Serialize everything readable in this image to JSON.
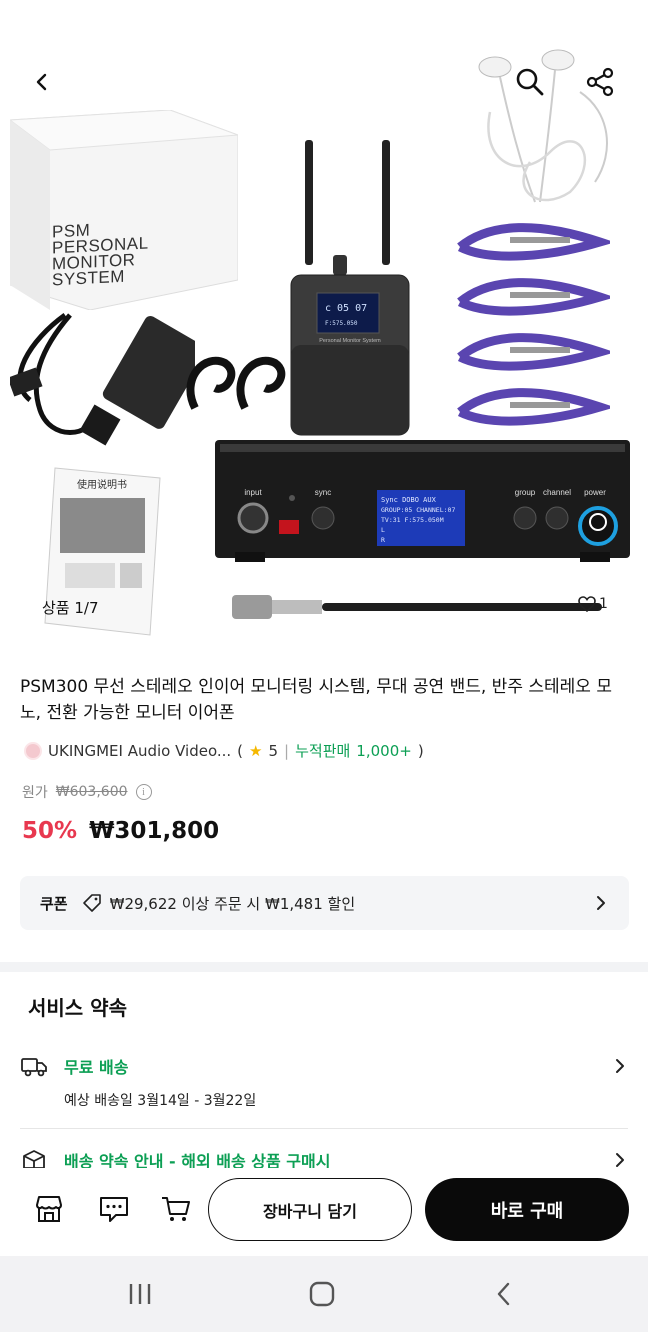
{
  "hero": {
    "box_text": [
      "PSM",
      "PERSONAL",
      "MONITOR",
      "SYSTEM"
    ],
    "counter": "상품 1/7",
    "likes": "1",
    "receiver_label": "Personal Monitor System",
    "manual_label": "使用说明书",
    "transmitter": {
      "input_label": "input",
      "sync_label": "sync",
      "group_label": "group",
      "channel_label": "channel",
      "power_label": "power",
      "screen_line1": "Sync    DOBO   AUX",
      "screen_line2": "GROUP:05  CHANNEL:07",
      "screen_line3": "TV:31    F:575.050M"
    }
  },
  "product": {
    "title": "PSM300 무선 스테레오 인이어 모니터링 시스템, 무대 공연 밴드, 반주 스테레오 모노, 전환 가능한 모니터 이어폰",
    "seller_name": "UKINGMEI Audio Video...",
    "rating_open": "(",
    "rating": "5",
    "rating_sep": "|",
    "sales_label": "누적판매",
    "sales": "1,000+",
    "rating_close": ")",
    "orig_label": "원가",
    "orig_price": "₩603,600",
    "discount": "50%",
    "price": "₩301,800"
  },
  "coupon": {
    "label": "쿠폰",
    "text": "₩29,622 이상 주문 시 ₩1,481 할인"
  },
  "service": {
    "title": "서비스 약속",
    "rows": [
      {
        "head": "무료 배송",
        "sub": "예상 배송일 3월14일 - 3월22일"
      },
      {
        "head": "배송 약속 안내 - 해외 배송 상품 구매시"
      }
    ]
  },
  "actions": {
    "cart": "장바구니 담기",
    "buy": "바로 구매"
  },
  "colors": {
    "accent_red": "#e8384f",
    "accent_green": "#0c9f54",
    "primary_dark": "#0a0a0a"
  }
}
